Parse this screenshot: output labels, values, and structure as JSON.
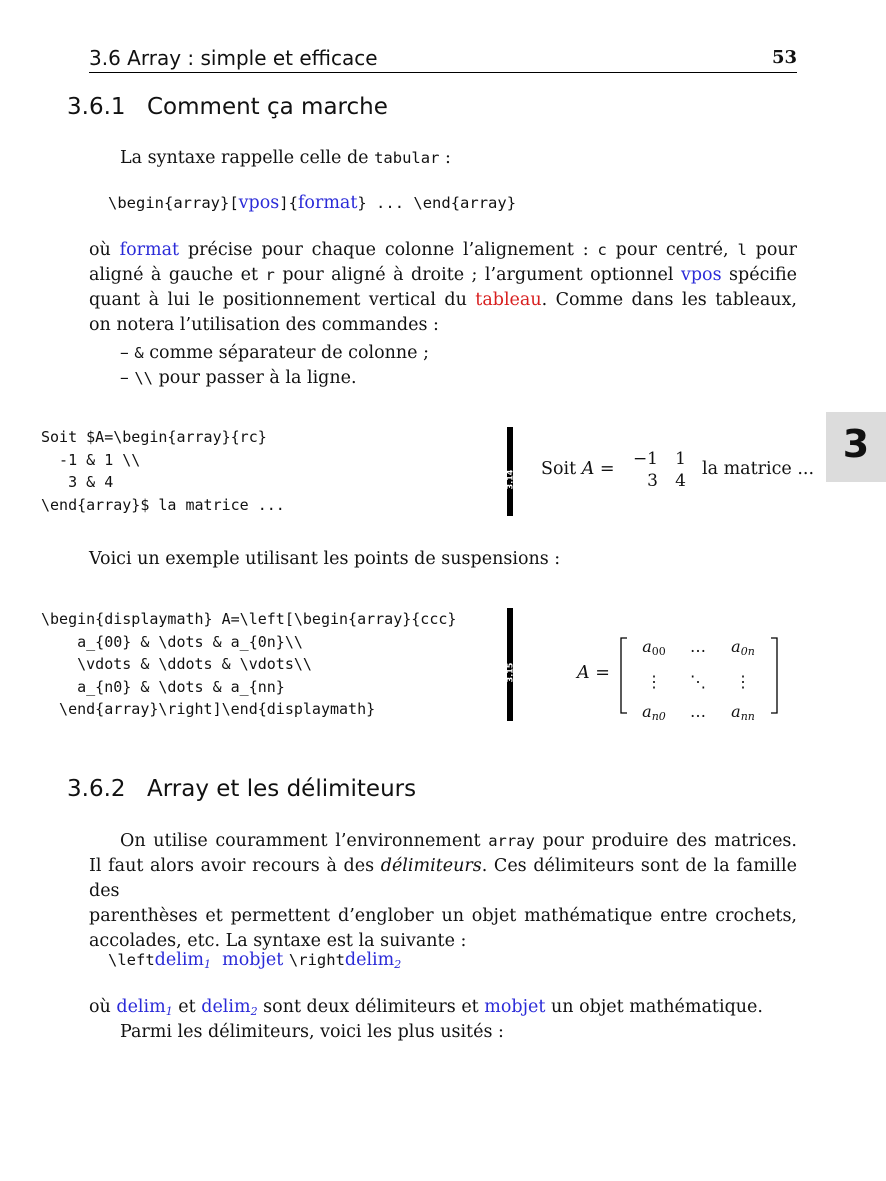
{
  "header": {
    "section": "3.6 Array : simple et efficace",
    "page_number": "53"
  },
  "chapter_tab": "3",
  "s1": {
    "num": "3.6.1",
    "title": "Comment ça marche",
    "intro": "La syntaxe rappelle celle de",
    "intro_code": "tabular",
    "intro_end": " :",
    "syntax": {
      "a": "\\begin{array}[",
      "vpos": "vpos",
      "b": "]{",
      "format": "format",
      "c": "} ... \\end{array}"
    },
    "para": {
      "l1_a": "où ",
      "l1_format": "format",
      "l1_b": " précise pour chaque colonne l’alignement : ",
      "l1_c": "c",
      "l1_d": " pour centré, ",
      "l1_l": "l",
      "l1_e": " pour",
      "l2_a": "aligné à gauche et ",
      "l2_r": "r",
      "l2_b": " pour aligné à droite ; l’argument optionnel ",
      "l2_vpos": "vpos",
      "l2_c": " spécifie",
      "l3_a": "quant à lui le positionnement vertical du ",
      "l3_tableau": "tableau",
      "l3_b": ". Comme dans les tableaux,",
      "l4": "on notera l’utilisation des commandes :"
    },
    "bullets": [
      {
        "dash": "–",
        "code": "&",
        "text": " comme séparateur de colonne ;"
      },
      {
        "dash": "–",
        "code": "\\\\",
        "text": " pour passer à la ligne."
      }
    ]
  },
  "ex1": {
    "code": [
      "Soit $A=\\begin{array}{rc}",
      "  -1 & 1 \\\\",
      "   3 & 4",
      "\\end{array}$ la matrice ..."
    ],
    "badge": "3.14",
    "out_pre": "Soit ",
    "out_var": "A",
    "out_eq": " =",
    "matrix": [
      [
        "−1",
        "1"
      ],
      [
        "3",
        "4"
      ]
    ],
    "out_post": "la matrice ..."
  },
  "mid_text": "Voici un exemple utilisant les points de suspensions :",
  "ex2": {
    "code": [
      "\\begin{displaymath} A=\\left[\\begin{array}{ccc}",
      "    a_{00} & \\dots & a_{0n}\\\\",
      "    \\vdots & \\ddots & \\vdots\\\\",
      "    a_{n0} & \\dots & a_{nn}",
      "  \\end{array}\\right]\\end{displaymath}"
    ],
    "badge": "3.15",
    "lhs": "A",
    "eq": "=",
    "cells": {
      "r1": {
        "a": "a",
        "a_sub": "00",
        "dots": "…",
        "c": "a",
        "c_sub": "0n"
      },
      "r2": {
        "a": "⋮",
        "dots": "⋱",
        "c": "⋮"
      },
      "r3": {
        "a": "a",
        "a_sub": "n0",
        "dots": "…",
        "c": "a",
        "c_sub": "nn"
      }
    }
  },
  "s2": {
    "num": "3.6.2",
    "title": "Array et les délimiteurs",
    "p1": {
      "l1_a": "On utilise couramment l’environnement ",
      "l1_code": "array",
      "l1_b": " pour produire des matrices.",
      "l2_a": "Il faut alors avoir recours à des ",
      "l2_em": "délimiteurs",
      "l2_b": ". Ces délimiteurs sont de la famille des",
      "l3": "parenthèses et permettent d’englober un objet mathématique entre crochets,",
      "l4": "accolades, etc. La syntaxe est la suivante :"
    },
    "syntax": {
      "left": "\\left",
      "delim": "delim",
      "sub1": "1",
      "mobjet": "mobjet",
      "right": "\\right",
      "sub2": "2"
    },
    "p2": {
      "a": "où ",
      "delim": "delim",
      "sub1": "1",
      "b": " et ",
      "sub2": "2",
      "c": " sont deux délimiteurs et ",
      "mobjet": "mobjet",
      "d": " un objet mathématique."
    },
    "p3": "Parmi les délimiteurs, voici les plus usités :"
  }
}
